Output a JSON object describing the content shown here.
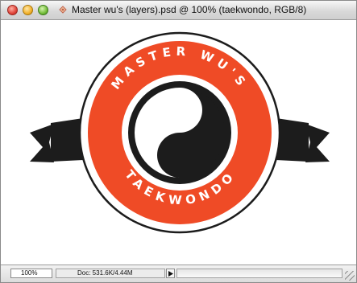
{
  "window": {
    "title": "Master wu's (layers).psd @ 100% (taekwondo, RGB/8)"
  },
  "logo": {
    "top_text": "MASTER WU'S",
    "bottom_text": "TAEKWONDO",
    "colors": {
      "ring": "#ef4b26",
      "dark": "#1c1c1c",
      "light": "#ffffff"
    }
  },
  "statusbar": {
    "zoom": "100%",
    "doc_info": "Doc: 531.6K/4.44M"
  },
  "icons": {
    "close": "close-button-icon",
    "minimize": "minimize-button-icon",
    "zoom": "zoom-button-icon",
    "document": "document-proxy-icon",
    "status_menu": "triangle-right-icon",
    "resize": "resize-grip-icon"
  }
}
